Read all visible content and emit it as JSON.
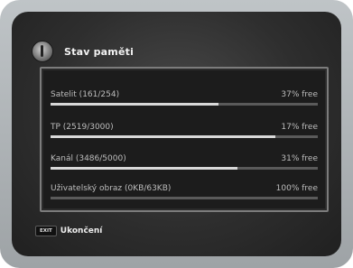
{
  "window": {
    "title": "Stav paměti",
    "icon": "memory-icon"
  },
  "memory_items": [
    {
      "label": "Satelit (161/254)",
      "free": "37% free",
      "used_fraction": 0.63
    },
    {
      "label": "TP (2519/3000)",
      "free": "17% free",
      "used_fraction": 0.84
    },
    {
      "label": "Kanál (3486/5000)",
      "free": "31% free",
      "used_fraction": 0.7
    },
    {
      "label": "Uživatelský obraz (0KB/63KB)",
      "free": "100% free",
      "used_fraction": 0.0
    }
  ],
  "footer": {
    "key": "EXIT",
    "label": "Ukončení"
  },
  "colors": {
    "background": "#2e2e2e",
    "text": "#bdbdbd",
    "bar_fill": "#d8d8d8",
    "bar_track": "#5a5a5a",
    "bezel": "#b0b5b8"
  }
}
